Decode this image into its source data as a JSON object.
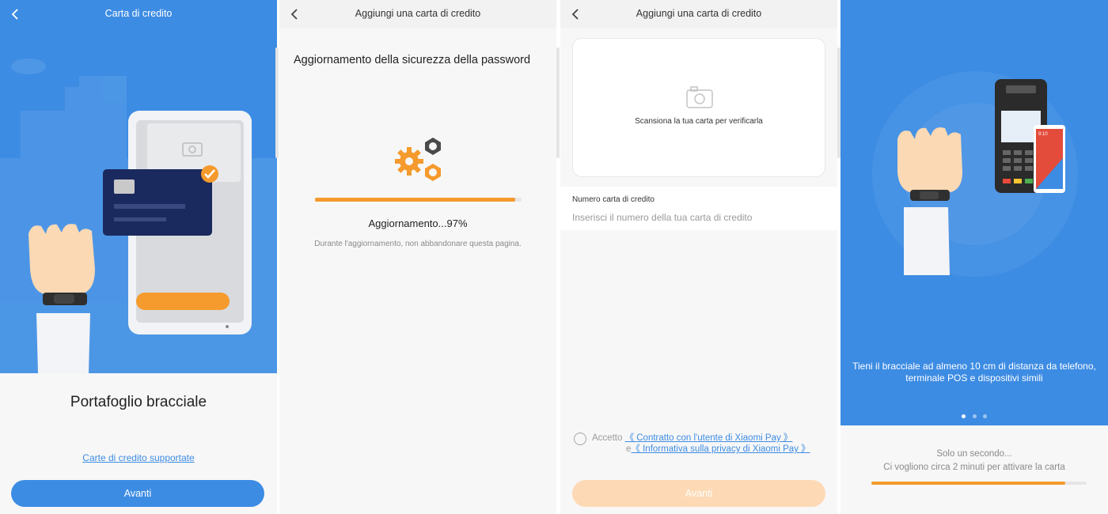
{
  "screen1": {
    "title": "Carta di credito",
    "heading": "Portafoglio bracciale",
    "supported_link": "Carte di credito supportate",
    "next_button": "Avanti"
  },
  "screen2": {
    "title": "Aggiungi una carta di credito",
    "heading": "Aggiornamento della sicurezza della password",
    "progress": 0.97,
    "status": "Aggiornamento...97%",
    "note": "Durante l'aggiornamento, non abbandonare questa pagina."
  },
  "screen3": {
    "title": "Aggiungi una carta di credito",
    "scan_text": "Scansiona la tua carta per verificarla",
    "card_number_label": "Numero carta di credito",
    "card_number_placeholder": "Inserisci il numero della tua carta di credito",
    "accept_text": "Accetto",
    "agreement_link": "《 Contratto con l'utente di Xiaomi Pay 》",
    "and_text": "e",
    "privacy_link": "《 Informativa sulla privacy di Xiaomi Pay 》",
    "next_button": "Avanti"
  },
  "screen4": {
    "instruction": "Tieni il bracciale ad almeno 10 cm di distanza da telefono, terminale POS e dispositivi simili",
    "pos_time": "9:10",
    "wait_text": "Solo un secondo...",
    "hint_text": "Ci vogliono circa 2 minuti per attivare la carta",
    "progress": 0.9,
    "page_count": 3,
    "active_page": 1
  },
  "colors": {
    "brand_blue": "#3d8ce3",
    "accent_orange": "#f59a2c",
    "disabled_orange": "#fdd9b5",
    "gear_gray": "#4a4a4a"
  },
  "icons": {
    "back": "chevron-left-icon",
    "camera": "camera-icon",
    "gears": "gears-icon",
    "checkmark": "checkmark-icon"
  }
}
